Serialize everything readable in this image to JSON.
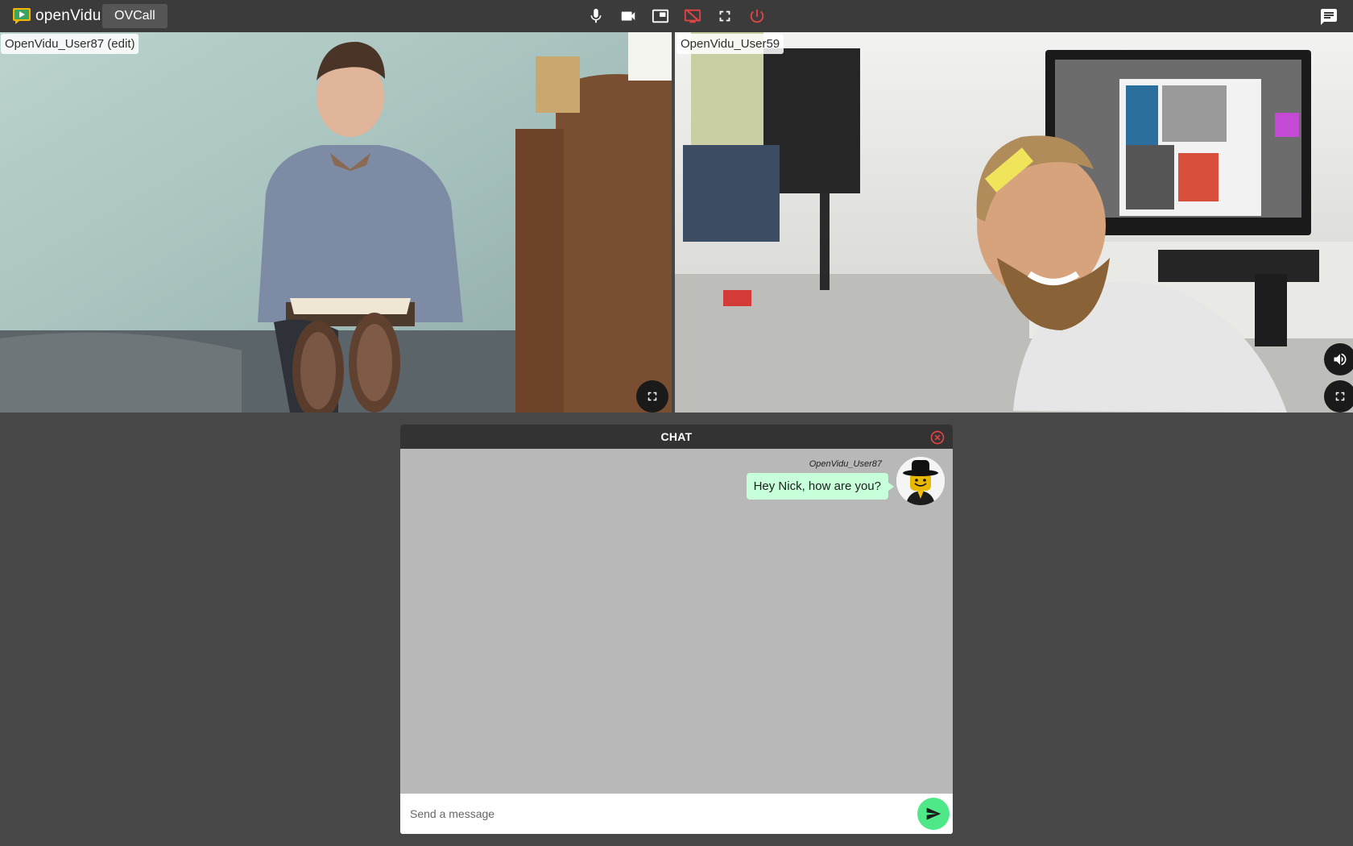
{
  "toolbar": {
    "logo_text": "openVidu",
    "session_name": "OVCall",
    "icons": [
      "mic-icon",
      "videocam-icon",
      "picture-in-picture-icon",
      "screen-share-off-icon",
      "fullscreen-icon",
      "power-icon",
      "chat-icon"
    ]
  },
  "local": {
    "nickname": "OpenVidu_User87 (edit)"
  },
  "remote": {
    "nickname": "OpenVidu_User59"
  },
  "chat": {
    "title": "CHAT",
    "messages": [
      {
        "author": "OpenVidu_User87",
        "text": "Hey Nick, how are you?"
      }
    ],
    "input_placeholder": "Send a message"
  },
  "colors": {
    "background": "#474747",
    "toolbar": "#3b3b3b",
    "danger": "#e24444",
    "bubble": "#c6ffd9",
    "send": "#4fe889"
  }
}
